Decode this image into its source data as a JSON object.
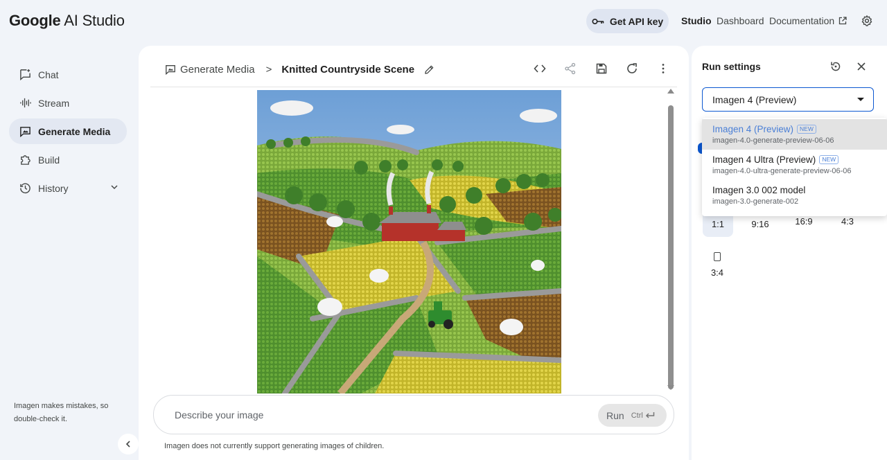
{
  "header": {
    "logo_google": "Google",
    "logo_rest": " AI Studio",
    "api_key_label": "Get API key",
    "nav": [
      {
        "label": "Studio"
      },
      {
        "label": "Dashboard"
      },
      {
        "label": "Documentation"
      }
    ]
  },
  "sidebar": {
    "items": [
      {
        "label": "Chat",
        "icon": "chat-icon"
      },
      {
        "label": "Stream",
        "icon": "waveform-icon"
      },
      {
        "label": "Generate Media",
        "icon": "media-icon",
        "active": true
      },
      {
        "label": "Build",
        "icon": "puzzle-icon"
      },
      {
        "label": "History",
        "icon": "history-icon"
      }
    ],
    "note": "Imagen makes mistakes, so double-check it."
  },
  "main": {
    "breadcrumb_root": "Generate Media",
    "breadcrumb_sep": ">",
    "title": "Knitted Countryside Scene",
    "image_alt": "Knitted countryside scene with farmhouse, sheep and tractor",
    "prompt_placeholder": "Describe your image",
    "run_label": "Run",
    "run_shortcut": "Ctrl",
    "disclaimer": "Imagen does not currently support generating images of children."
  },
  "settings": {
    "title": "Run settings",
    "selected_model": "Imagen 4 (Preview)",
    "accent": "#0b57d0",
    "model_options": [
      {
        "name": "Imagen 4 (Preview)",
        "id": "imagen-4.0-generate-preview-06-06",
        "badge": "NEW",
        "selected": true
      },
      {
        "name": "Imagen 4 Ultra (Preview)",
        "id": "imagen-4.0-ultra-generate-preview-06-06",
        "badge": "NEW"
      },
      {
        "name": "Imagen 3.0 002 model",
        "id": "imagen-3.0-generate-002"
      }
    ],
    "aspect_ratios": [
      {
        "label": "1:1",
        "active": true
      },
      {
        "label": "9:16"
      },
      {
        "label": "16:9"
      },
      {
        "label": "4:3"
      },
      {
        "label": "3:4"
      }
    ]
  }
}
